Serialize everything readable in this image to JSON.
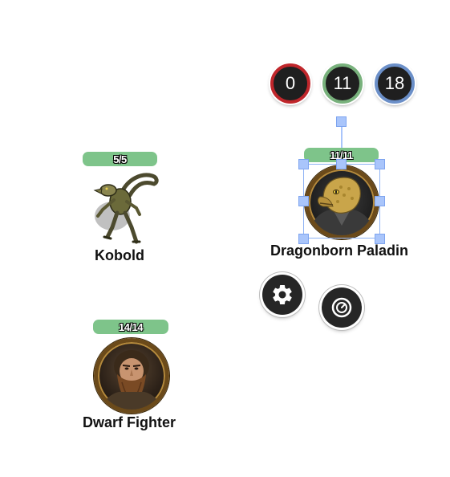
{
  "stats": {
    "red_value": "0",
    "green_value": "11",
    "blue_value": "18",
    "red_color": "#c0262b",
    "green_color": "#78b17c",
    "blue_color": "#6b8fc8"
  },
  "tokens": {
    "kobold": {
      "name": "Kobold",
      "hp": "5/5",
      "hp_fraction": 1.0
    },
    "dwarf": {
      "name": "Dwarf Fighter",
      "hp": "14/14",
      "hp_fraction": 1.0
    },
    "dragonborn": {
      "name": "Dragonborn Paladin",
      "hp": "11/11",
      "hp_fraction": 1.0,
      "selected": true
    }
  },
  "actions": {
    "settings_icon": "gear-icon",
    "gauge_icon": "gauge-icon"
  },
  "colors": {
    "hp_bar": "#7ec48a",
    "selection": "#a9c5fb"
  }
}
